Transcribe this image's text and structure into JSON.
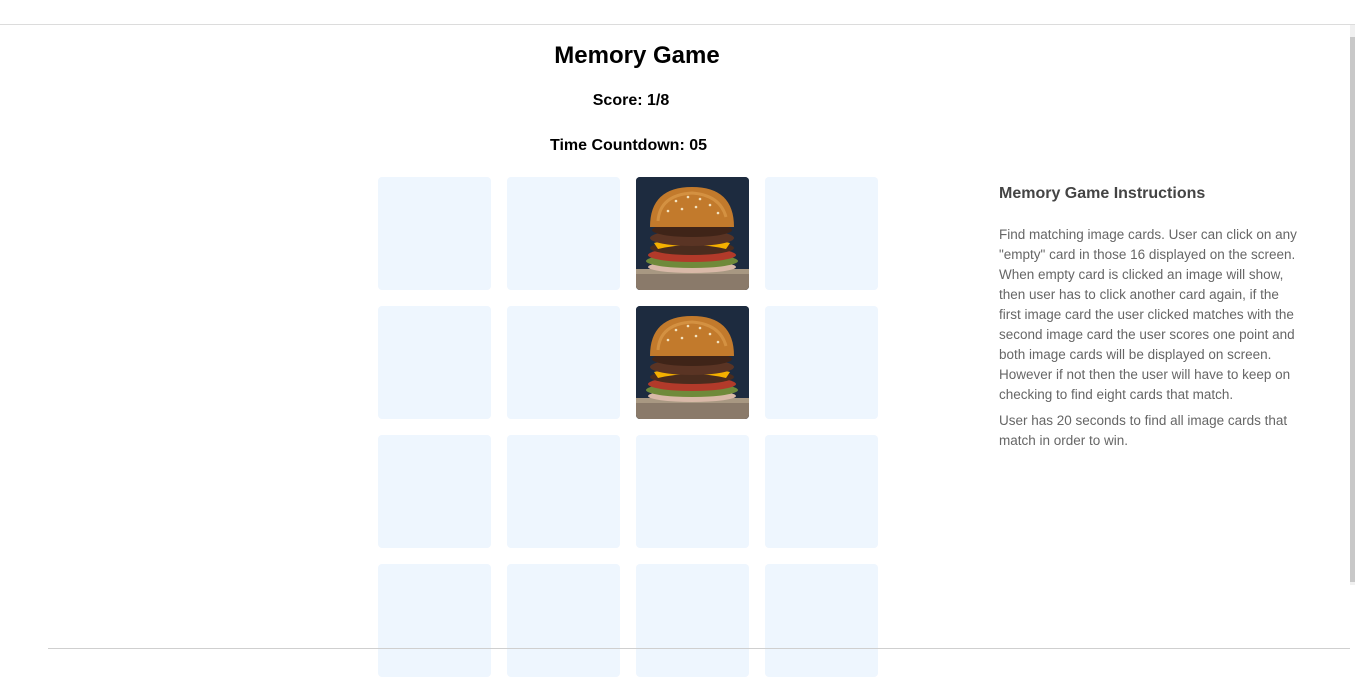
{
  "header": {
    "title": "Memory Game",
    "score": "Score: 1/8",
    "timer": "Time Countdown: 05"
  },
  "board": {
    "rows": 4,
    "cols": 4,
    "cards": [
      {
        "state": "empty"
      },
      {
        "state": "empty"
      },
      {
        "state": "revealed",
        "image": "burger"
      },
      {
        "state": "empty"
      },
      {
        "state": "empty"
      },
      {
        "state": "empty"
      },
      {
        "state": "revealed",
        "image": "burger"
      },
      {
        "state": "empty"
      },
      {
        "state": "empty"
      },
      {
        "state": "empty"
      },
      {
        "state": "empty"
      },
      {
        "state": "empty"
      },
      {
        "state": "empty"
      },
      {
        "state": "empty"
      },
      {
        "state": "empty"
      },
      {
        "state": "empty"
      }
    ],
    "empty_color": "#eef6fe"
  },
  "instructions": {
    "heading": "Memory Game Instructions",
    "paragraph1": "Find matching image cards. User can click on any \"empty\" card in those 16 displayed on the screen. When empty card is clicked an image will show, then user has to click another card again, if the first image card the user clicked matches with the second image card the user scores one point and both image cards will be displayed on screen. However if not then the user will have to keep on checking to find eight cards that match.",
    "paragraph2": "User has 20 seconds to find all image cards that match in order to win."
  }
}
